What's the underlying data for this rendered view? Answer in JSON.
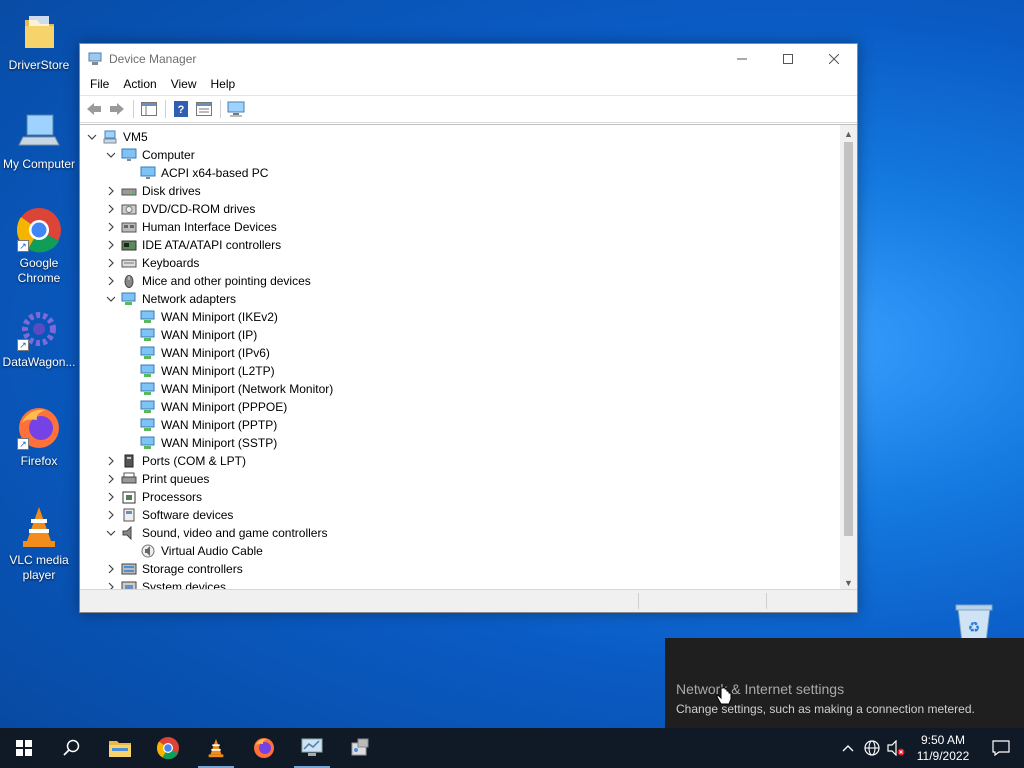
{
  "desktop": {
    "icons": [
      {
        "label": "DriverStore"
      },
      {
        "label": "My Computer"
      },
      {
        "label": "Google Chrome"
      },
      {
        "label": "DataWagon..."
      },
      {
        "label": "Firefox"
      },
      {
        "label": "VLC media player"
      }
    ]
  },
  "window": {
    "title": "Device Manager",
    "controls": {
      "minimize": "—",
      "maximize": "☐",
      "close": "✕"
    },
    "menu": [
      "File",
      "Action",
      "View",
      "Help"
    ]
  },
  "tree": [
    {
      "level": 0,
      "expander": "open",
      "icon": "computer-node-icon",
      "label": "VM5"
    },
    {
      "level": 1,
      "expander": "open",
      "icon": "monitor-icon",
      "label": "Computer"
    },
    {
      "level": 2,
      "expander": "none",
      "icon": "monitor-icon",
      "label": "ACPI x64-based PC"
    },
    {
      "level": 1,
      "expander": "closed",
      "icon": "disk-drive-icon",
      "label": "Disk drives"
    },
    {
      "level": 1,
      "expander": "closed",
      "icon": "dvd-drive-icon",
      "label": "DVD/CD-ROM drives"
    },
    {
      "level": 1,
      "expander": "closed",
      "icon": "hid-icon",
      "label": "Human Interface Devices"
    },
    {
      "level": 1,
      "expander": "closed",
      "icon": "ide-controller-icon",
      "label": "IDE ATA/ATAPI controllers"
    },
    {
      "level": 1,
      "expander": "closed",
      "icon": "keyboard-icon",
      "label": "Keyboards"
    },
    {
      "level": 1,
      "expander": "closed",
      "icon": "mouse-icon",
      "label": "Mice and other pointing devices"
    },
    {
      "level": 1,
      "expander": "open",
      "icon": "network-adapter-icon",
      "label": "Network adapters"
    },
    {
      "level": 2,
      "expander": "none",
      "icon": "network-adapter-icon",
      "label": "WAN Miniport (IKEv2)"
    },
    {
      "level": 2,
      "expander": "none",
      "icon": "network-adapter-icon",
      "label": "WAN Miniport (IP)"
    },
    {
      "level": 2,
      "expander": "none",
      "icon": "network-adapter-icon",
      "label": "WAN Miniport (IPv6)"
    },
    {
      "level": 2,
      "expander": "none",
      "icon": "network-adapter-icon",
      "label": "WAN Miniport (L2TP)"
    },
    {
      "level": 2,
      "expander": "none",
      "icon": "network-adapter-icon",
      "label": "WAN Miniport (Network Monitor)"
    },
    {
      "level": 2,
      "expander": "none",
      "icon": "network-adapter-icon",
      "label": "WAN Miniport (PPPOE)"
    },
    {
      "level": 2,
      "expander": "none",
      "icon": "network-adapter-icon",
      "label": "WAN Miniport (PPTP)"
    },
    {
      "level": 2,
      "expander": "none",
      "icon": "network-adapter-icon",
      "label": "WAN Miniport (SSTP)"
    },
    {
      "level": 1,
      "expander": "closed",
      "icon": "port-icon",
      "label": "Ports (COM & LPT)"
    },
    {
      "level": 1,
      "expander": "closed",
      "icon": "printer-icon",
      "label": "Print queues"
    },
    {
      "level": 1,
      "expander": "closed",
      "icon": "processor-icon",
      "label": "Processors"
    },
    {
      "level": 1,
      "expander": "closed",
      "icon": "software-device-icon",
      "label": "Software devices"
    },
    {
      "level": 1,
      "expander": "open",
      "icon": "speaker-icon",
      "label": "Sound, video and game controllers"
    },
    {
      "level": 2,
      "expander": "none",
      "icon": "audio-device-icon",
      "label": "Virtual Audio Cable"
    },
    {
      "level": 1,
      "expander": "closed",
      "icon": "storage-controller-icon",
      "label": "Storage controllers"
    },
    {
      "level": 1,
      "expander": "closed",
      "icon": "system-device-icon",
      "label": "System devices"
    }
  ],
  "notification": {
    "title": "Network & Internet settings",
    "body": "Change settings, such as making a connection metered."
  },
  "taskbar": {
    "pinned": [
      "start-icon",
      "search-icon",
      "file-explorer-icon",
      "chrome-icon",
      "vlc-icon",
      "firefox-icon",
      "device-manager-icon",
      "network-app-icon"
    ],
    "clock": {
      "time": "9:50 AM",
      "date": "11/9/2022"
    }
  },
  "colors": {
    "desktop": "#0a5bc4",
    "taskbar": "#101a26",
    "toast": "#1f1f1f",
    "selection_accent": "#7aa6d6"
  }
}
